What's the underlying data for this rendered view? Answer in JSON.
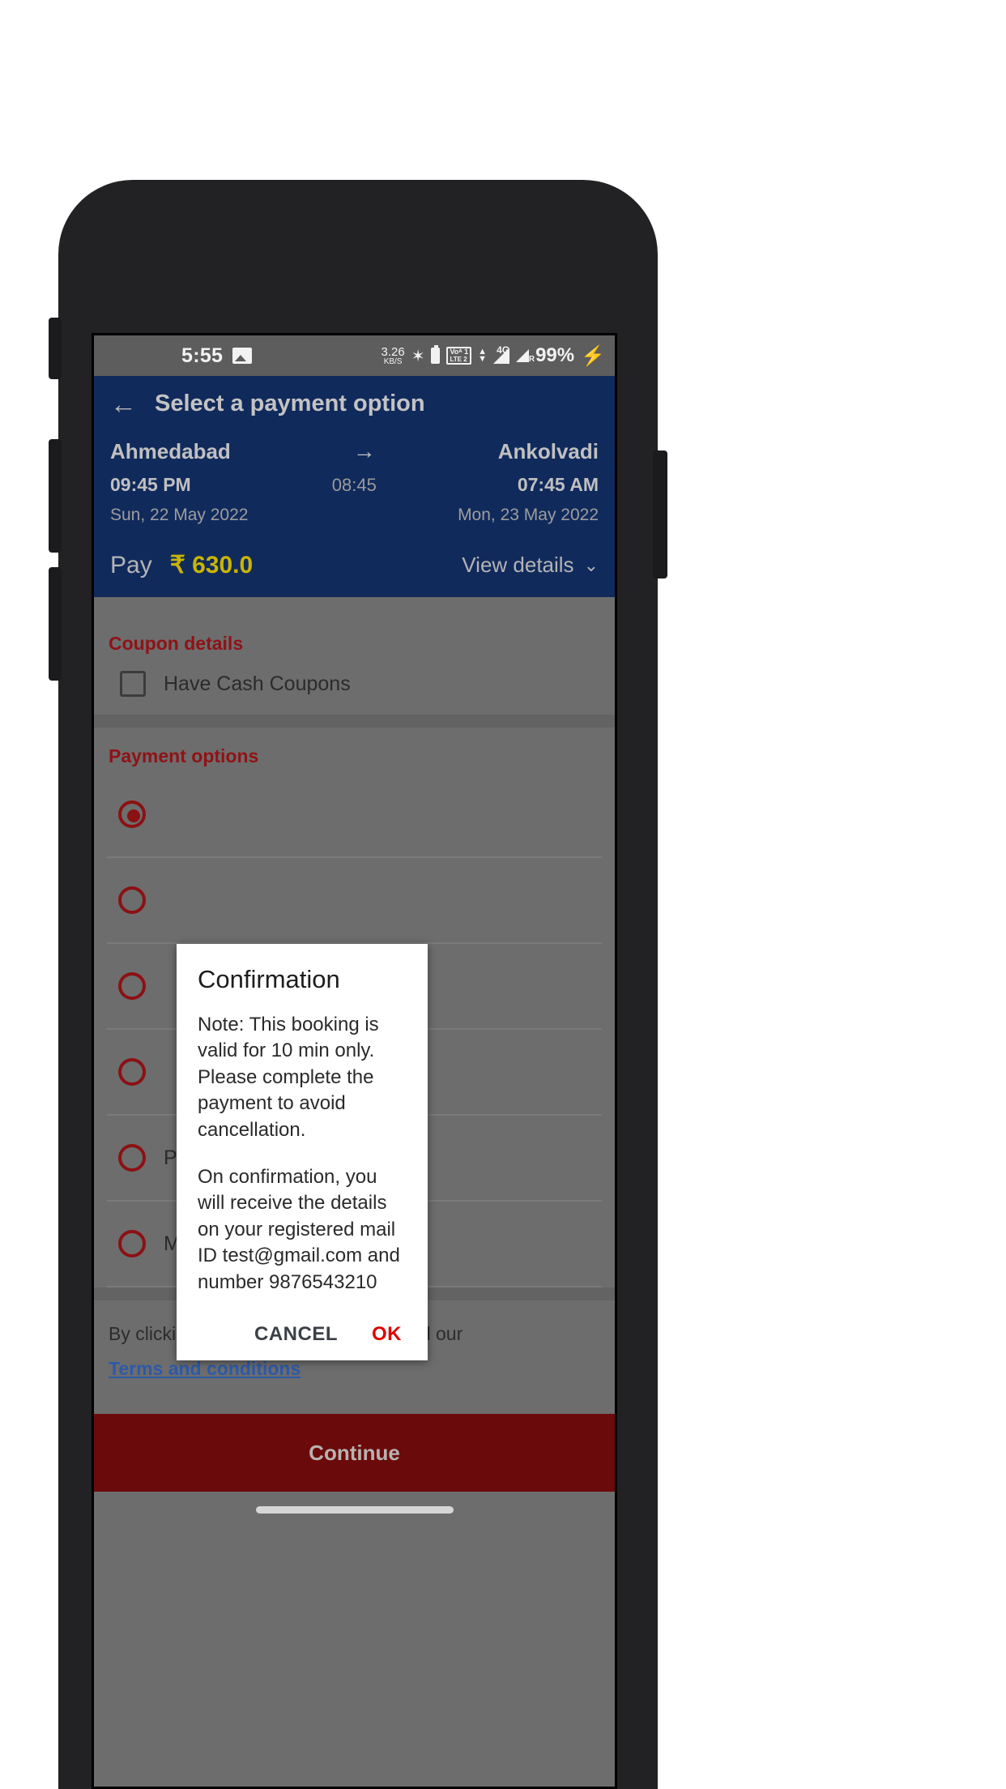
{
  "status_bar": {
    "time": "5:55",
    "image_icon": "image-icon",
    "data_rate": "3.26",
    "data_rate_unit": "KB/S",
    "bluetooth_icon": "bluetooth-icon",
    "battery_small_icon": "battery-icon",
    "volte_line1": "Voᴬ 1",
    "volte_line2": "LTE 2",
    "network_type": "4G",
    "roaming_label": "R",
    "battery_percent": "99%",
    "charging_icon": "charging-bolt-icon"
  },
  "appbar": {
    "back_icon": "back-arrow-icon",
    "title": "Select a payment option"
  },
  "journey": {
    "from_city": "Ahmedabad",
    "to_city": "Ankolvadi",
    "direction_icon": "arrow-right-icon",
    "depart_time": "09:45 PM",
    "duration": "08:45",
    "arrive_time": "07:45 AM",
    "depart_date": "Sun, 22 May 2022",
    "arrive_date": "Mon, 23 May 2022"
  },
  "fare": {
    "pay_label": "Pay",
    "amount": "₹ 630.0",
    "view_details_label": "View details",
    "chevron_icon": "chevron-down-icon"
  },
  "coupon": {
    "section_title": "Coupon details",
    "checkbox_label": "Have Cash Coupons",
    "checked": false
  },
  "payment": {
    "section_title": "Payment options",
    "options": [
      {
        "label": "",
        "selected": true
      },
      {
        "label": "",
        "selected": false
      },
      {
        "label": "",
        "selected": false
      },
      {
        "label": "",
        "selected": false
      },
      {
        "label": "Paytm Wallet",
        "selected": false
      },
      {
        "label": "Mobikwik Wallet",
        "selected": false
      }
    ]
  },
  "terms": {
    "text": "By clicking on continue you agree to all our",
    "link": "Terms and conditions"
  },
  "footer": {
    "continue_label": "Continue"
  },
  "dialog": {
    "title": "Confirmation",
    "paragraph1": "Note: This booking is valid for 10 min only. Please complete the payment to avoid cancellation.",
    "paragraph2": "On confirmation, you will receive the details on your registered mail ID test@gmail.com and number 9876543210",
    "cancel_label": "CANCEL",
    "ok_label": "OK"
  },
  "colors": {
    "appbar": "#112a5c",
    "accent_red": "#8b1114",
    "amount_gold": "#c9b400",
    "link_blue": "#2d5aa8",
    "continue_bg": "#6b0a0a",
    "ok_red": "#e00000"
  }
}
